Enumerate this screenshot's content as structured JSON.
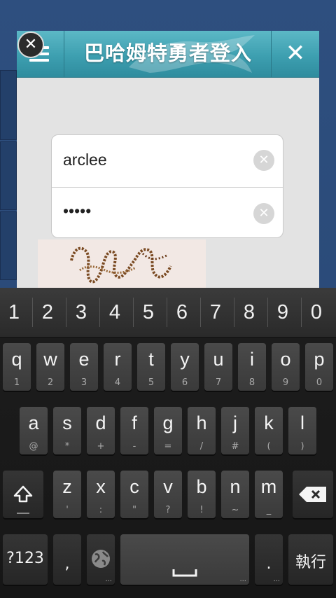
{
  "dialog": {
    "title": "巴哈姆特勇者登入",
    "close_glyph": "✕",
    "dismiss_glyph": "✕"
  },
  "form": {
    "username_value": "arclee",
    "password_value": "•••••",
    "clear_glyph": "✕"
  },
  "keyboard": {
    "number_row": [
      "1",
      "2",
      "3",
      "4",
      "5",
      "6",
      "7",
      "8",
      "9",
      "0"
    ],
    "row1": [
      {
        "main": "q",
        "sub": "1"
      },
      {
        "main": "w",
        "sub": "2"
      },
      {
        "main": "e",
        "sub": "3"
      },
      {
        "main": "r",
        "sub": "4"
      },
      {
        "main": "t",
        "sub": "5"
      },
      {
        "main": "y",
        "sub": "6"
      },
      {
        "main": "u",
        "sub": "7"
      },
      {
        "main": "i",
        "sub": "8"
      },
      {
        "main": "o",
        "sub": "9"
      },
      {
        "main": "p",
        "sub": "0"
      }
    ],
    "row2": [
      {
        "main": "a",
        "sub": "@"
      },
      {
        "main": "s",
        "sub": "*"
      },
      {
        "main": "d",
        "sub": "+"
      },
      {
        "main": "f",
        "sub": "-"
      },
      {
        "main": "g",
        "sub": "="
      },
      {
        "main": "h",
        "sub": "/"
      },
      {
        "main": "j",
        "sub": "#"
      },
      {
        "main": "k",
        "sub": "("
      },
      {
        "main": "l",
        "sub": ")"
      }
    ],
    "row3": [
      {
        "main": "z",
        "sub": "'"
      },
      {
        "main": "x",
        "sub": ":"
      },
      {
        "main": "c",
        "sub": "\""
      },
      {
        "main": "v",
        "sub": "?"
      },
      {
        "main": "b",
        "sub": "!"
      },
      {
        "main": "n",
        "sub": "~"
      },
      {
        "main": "m",
        "sub": "_"
      }
    ],
    "symbols_label": "?123",
    "comma_label": ",",
    "period_label": ".",
    "enter_label": "執行",
    "shift_icon": "shift-icon",
    "backspace_icon": "backspace-icon",
    "globe_icon": "globe-icon",
    "space_icon": "space-icon"
  },
  "colors": {
    "header_accent": "#3d9fb0",
    "background": "#2e4f7f",
    "keyboard_bg": "#161616"
  }
}
